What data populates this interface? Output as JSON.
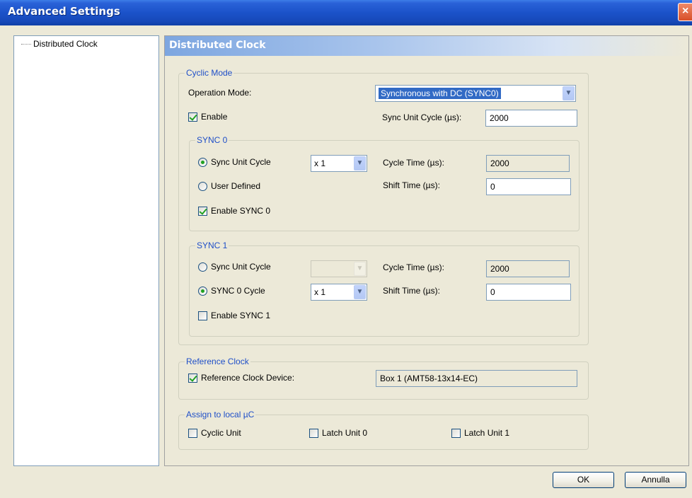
{
  "window": {
    "title": "Advanced Settings",
    "close_glyph": "×"
  },
  "tree": {
    "items": [
      {
        "label": "Distributed Clock"
      }
    ]
  },
  "panel": {
    "title": "Distributed Clock",
    "cyclic_mode": {
      "legend": "Cyclic Mode",
      "operation_mode_label": "Operation Mode:",
      "operation_mode_value": "Synchronous with DC (SYNC0)",
      "enable_label": "Enable",
      "enable_checked": true,
      "sync_unit_cycle_label": "Sync Unit Cycle (µs):",
      "sync_unit_cycle_value": "2000",
      "sync0": {
        "legend": "SYNC 0",
        "radio_sync_unit_cycle": "Sync Unit Cycle",
        "radio_user_defined": "User Defined",
        "selected": "sync_unit_cycle",
        "multiplier": "x 1",
        "cycle_time_label": "Cycle Time (µs):",
        "cycle_time_value": "2000",
        "shift_time_label": "Shift Time (µs):",
        "shift_time_value": "0",
        "enable_label": "Enable SYNC 0",
        "enable_checked": true
      },
      "sync1": {
        "legend": "SYNC 1",
        "radio_sync_unit_cycle": "Sync Unit Cycle",
        "radio_sync0_cycle": "SYNC 0 Cycle",
        "selected": "sync0_cycle",
        "multiplier": "x 1",
        "cycle_time_label": "Cycle Time (µs):",
        "cycle_time_value": "2000",
        "shift_time_label": "Shift Time (µs):",
        "shift_time_value": "0",
        "enable_label": "Enable SYNC 1",
        "enable_checked": false
      }
    },
    "reference_clock": {
      "legend": "Reference Clock",
      "device_label": "Reference Clock Device:",
      "device_checked": true,
      "device_value": "Box 1 (AMT58-13x14-EC)"
    },
    "assign_local": {
      "legend": "Assign to local µC",
      "cyclic_unit": "Cyclic Unit",
      "latch_unit_0": "Latch Unit 0",
      "latch_unit_1": "Latch Unit 1"
    }
  },
  "buttons": {
    "ok": "OK",
    "cancel": "Annulla"
  },
  "colors": {
    "title_bar": "#1b52c9",
    "legend_text": "#1f4fc8",
    "check_green": "#21a121",
    "selection": "#316ac5"
  }
}
